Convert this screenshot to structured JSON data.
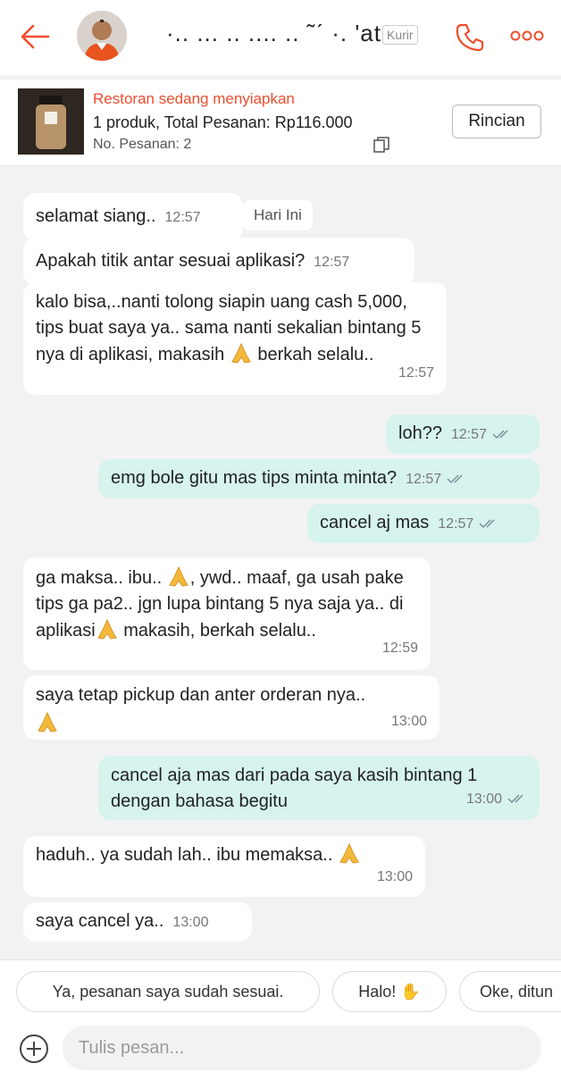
{
  "header": {
    "driver_name": "·.. ... .. .... .. ˜ˊ ·. 'at",
    "role_badge": "Kurir",
    "accent": "#ee4d2d"
  },
  "order": {
    "status": "Restoran sedang menyiapkan",
    "summary": "1 produk, Total Pesanan: Rp116.000",
    "number": "No. Pesanan: 2",
    "detail_button": "Rincian"
  },
  "chat": {
    "date_label": "Hari Ini",
    "messages": [
      {
        "side": "in",
        "text": "selamat siang..",
        "time": "12:57"
      },
      {
        "side": "in",
        "text": "Apakah titik antar sesuai aplikasi?",
        "time": "12:57"
      },
      {
        "side": "in",
        "text_1": "kalo bisa,..nanti tolong siapin uang cash 5,000, tips buat saya ya.. sama nanti sekalian  bintang 5 nya di aplikasi, makasih",
        "text_2": " berkah selalu..",
        "time": "12:57"
      },
      {
        "side": "out",
        "text": "loh??",
        "time": "12:57"
      },
      {
        "side": "out",
        "text": "emg bole gitu mas tips minta minta?",
        "time": "12:57"
      },
      {
        "side": "out",
        "text": "cancel aj mas",
        "time": "12:57"
      },
      {
        "side": "in",
        "text_1": "ga maksa.. ibu.. ",
        "text_2": ", ywd.. maaf, ga usah pake tips ga pa2.. jgn lupa bintang 5 nya saja ya.. di aplikasi",
        "text_3": " makasih, berkah selalu..",
        "time": "12:59"
      },
      {
        "side": "in",
        "text": "saya tetap pickup dan anter orderan nya..",
        "time": "13:00"
      },
      {
        "side": "out",
        "text": "cancel aja mas dari pada saya kasih bintang 1 dengan bahasa begitu",
        "time": "13:00"
      },
      {
        "side": "in",
        "text": "haduh.. ya sudah lah.. ibu memaksa.. ",
        "time": "13:00"
      },
      {
        "side": "in",
        "text": "saya cancel ya..",
        "time": "13:00"
      }
    ]
  },
  "quick_replies": [
    "Ya, pesanan saya sudah sesuai.",
    "Halo! ",
    "Oke, ditun"
  ],
  "input": {
    "placeholder": "Tulis pesan..."
  },
  "colors": {
    "incoming": "#ffffff",
    "outgoing": "#d6f3ee",
    "background": "#f2f2f2"
  }
}
